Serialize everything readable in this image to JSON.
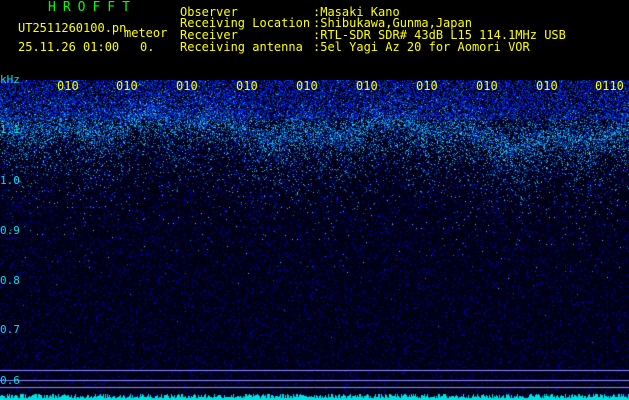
{
  "header": {
    "app_title": "HROFFT",
    "filename": "UT2511260100.pn",
    "meteor_label": "meteor",
    "datetime": "25.11.26 01:00",
    "meteor_count": "0."
  },
  "station": {
    "observer_label": "Observer",
    "observer_value": ":Masaki Kano",
    "location_label": "Receiving Location",
    "location_value": ":Shibukawa,Gunma,Japan",
    "receiver_label": "Receiver",
    "receiver_value": ":RTL-SDR SDR# 43dB L15 114.1MHz USB",
    "antenna_label": "Receiving antenna",
    "antenna_value": ":5el Yagi Az 20 for Aomori VOR"
  },
  "spectrogram": {
    "y_unit": "kHz",
    "y_ticks": [
      "1.1",
      "1.0",
      "0.9",
      "0.8",
      "0.7",
      "0.6"
    ],
    "x_ticks": [
      "010",
      "010",
      "010",
      "010",
      "010",
      "010",
      "010",
      "010",
      "010",
      "0110"
    ],
    "colors": {
      "background": "#00002a",
      "noise": "#0000a0",
      "signal": "#00ffff",
      "label_text": "#ffff00",
      "axis_text": "#00e0e0"
    }
  }
}
